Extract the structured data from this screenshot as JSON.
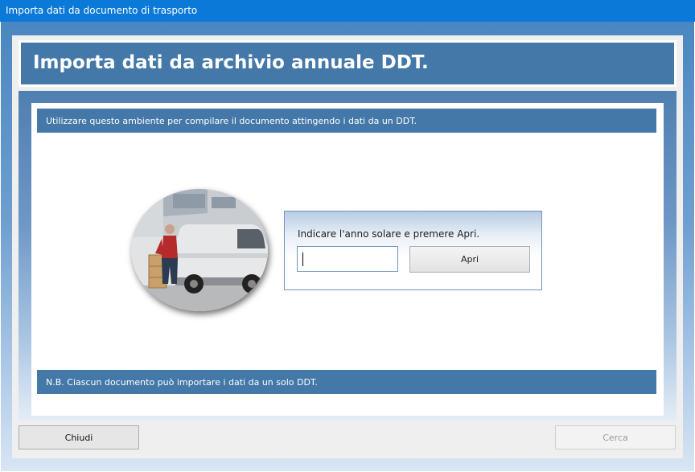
{
  "window": {
    "title": "Importa dati da documento di trasporto"
  },
  "header": {
    "title": "Importa dati da archivio annuale DDT."
  },
  "main": {
    "info_text": "Utilizzare questo ambiente per compilare il documento attingendo i dati da un DDT.",
    "note_text": "N.B. Ciascun documento può importare i dati da un solo DDT.",
    "photo_icon": "delivery-van-photo",
    "year_panel": {
      "label": "Indicare l'anno solare e premere Apri.",
      "year_value": "",
      "open_label": "Apri"
    }
  },
  "footer": {
    "close_label": "Chiudi",
    "search_label": "Cerca",
    "search_enabled": false
  },
  "colors": {
    "title_bar": "#0a79d8",
    "header_blue": "#4478a8",
    "panel_border": "#6f95bd"
  }
}
